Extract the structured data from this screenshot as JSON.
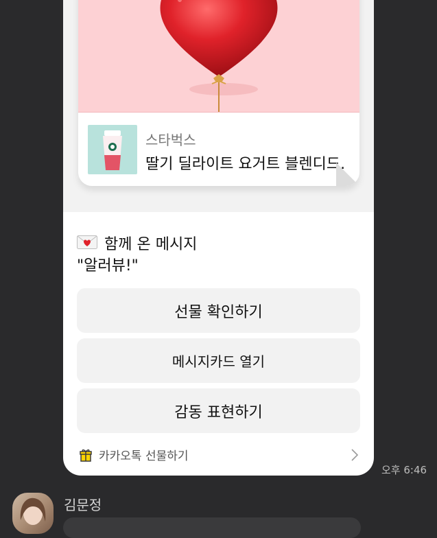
{
  "gift_card": {
    "brand": "스타벅스",
    "product_name": "딸기 딜라이트 요거트 블렌디드."
  },
  "message": {
    "title": "함께 온 메시지",
    "body": "\"알러뷰!\""
  },
  "buttons": {
    "check_gift": "선물 확인하기",
    "open_message_card": "메시지카드 열기",
    "express_thanks": "감동 표현하기"
  },
  "footer": {
    "label": "카카오톡 선물하기"
  },
  "timestamp": "오후 6:46",
  "next_message": {
    "sender": "김문정"
  },
  "colors": {
    "background": "#2a2a2c",
    "card_pink": "#fdd1d4",
    "heart_red": "#d81f26",
    "button_bg": "#f2f2f2"
  },
  "icons": {
    "heart_balloon": "heart-balloon-image",
    "message_emoji": "love-letter-emoji",
    "gift_box": "gift-box-icon",
    "chevron": "chevron-right-icon"
  }
}
